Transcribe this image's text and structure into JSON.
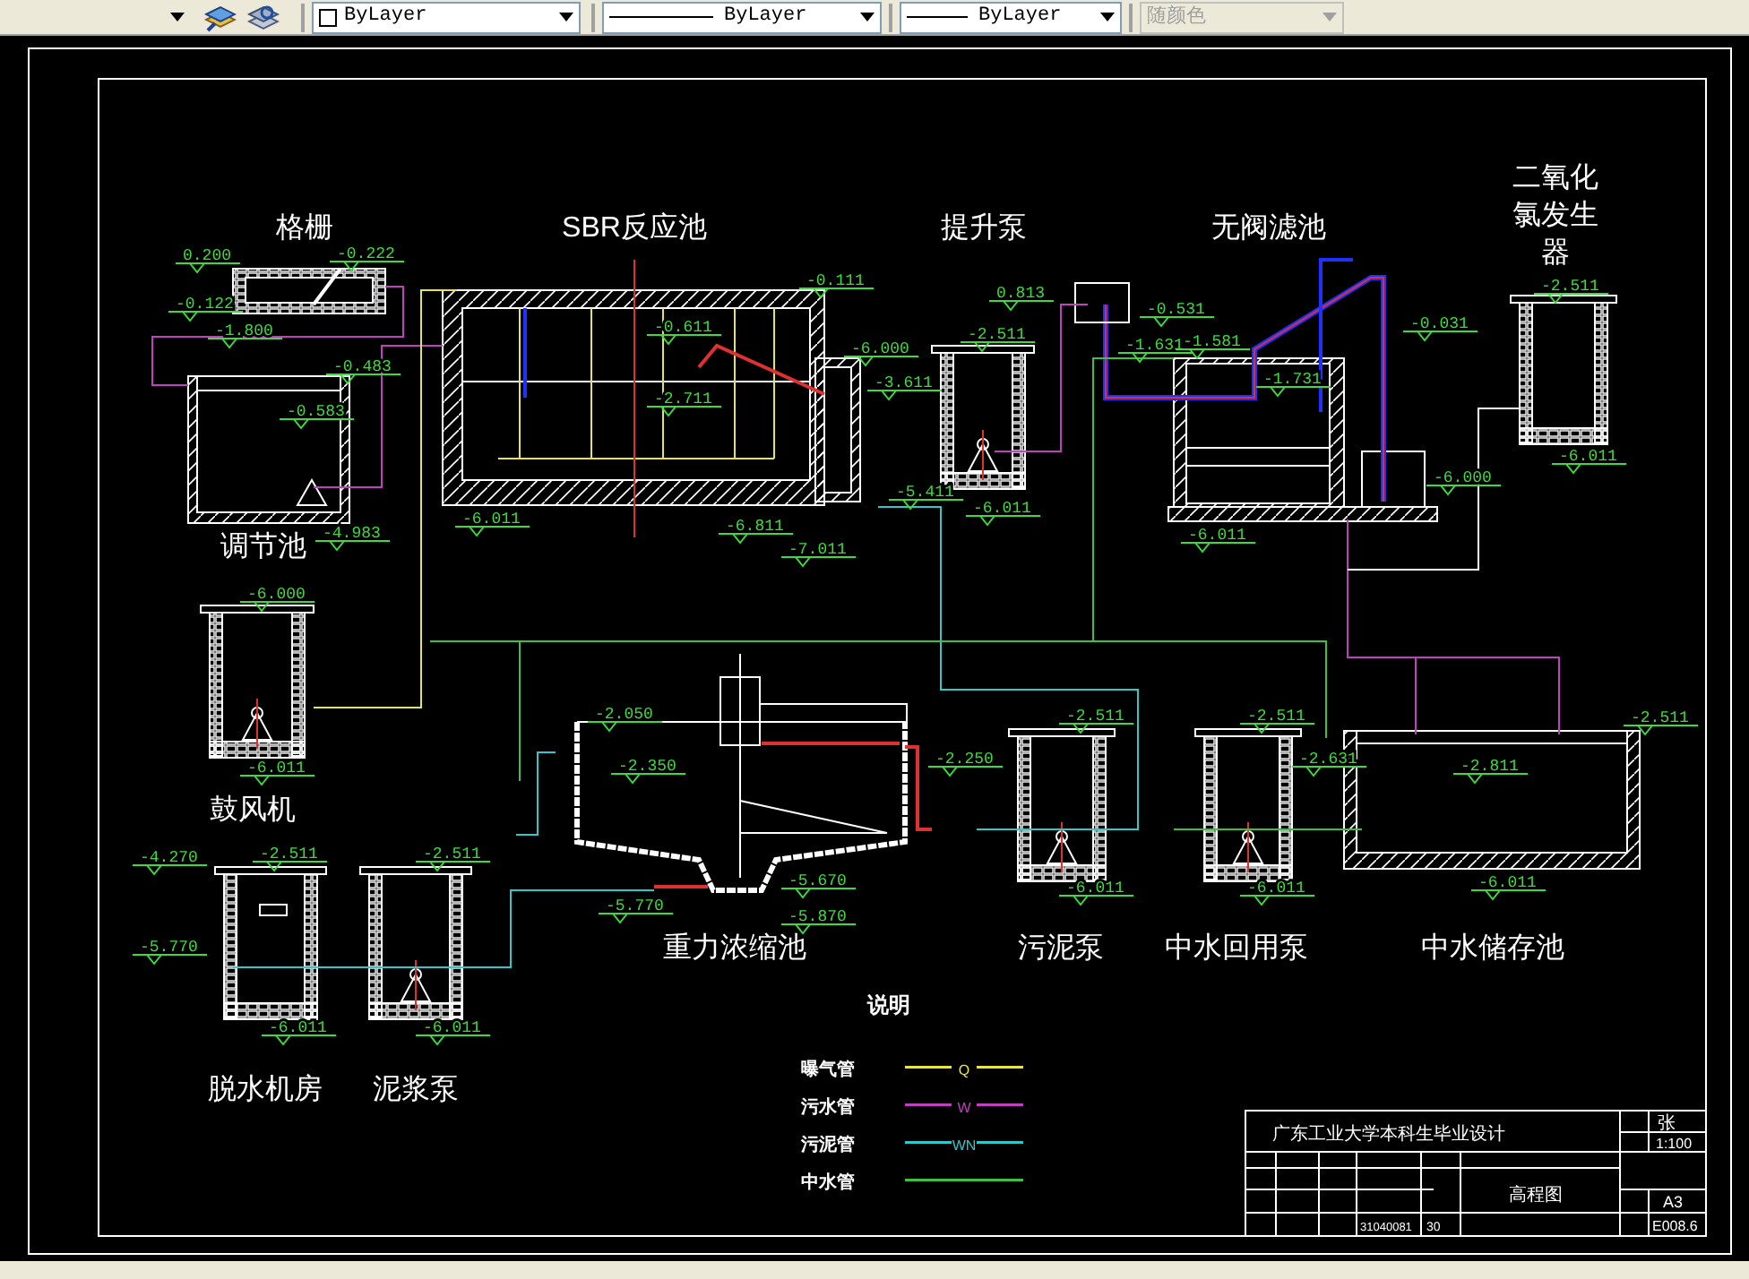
{
  "toolbar": {
    "color_control": "ByLayer",
    "linetype": "ByLayer",
    "lineweight": "ByLayer",
    "plot_style": {
      "value": "随颜色",
      "disabled": true
    }
  },
  "drawing": {
    "units": [
      {
        "name_lines": [
          "格栅"
        ],
        "elevations": [
          "0.200",
          "-0.122",
          "-0.222",
          "-1.800"
        ]
      },
      {
        "name_lines": [
          "调节池"
        ],
        "elevations": [
          "-0.483",
          "-0.583",
          "-4.983"
        ]
      },
      {
        "name_lines": [
          "SBR反应池"
        ],
        "elevations": [
          "-0.111",
          "-0.611",
          "-2.711",
          "-6.011",
          "-6.000",
          "-3.611",
          "-6.811",
          "-7.011"
        ]
      },
      {
        "name_lines": [
          "提升泵"
        ],
        "elevations": [
          "0.813",
          "-2.511",
          "-5.411",
          "-6.011"
        ]
      },
      {
        "name_lines": [
          "无阀滤池"
        ],
        "elevations": [
          "-0.531",
          "-1.631",
          "-1.581",
          "-1.731",
          "-0.031",
          "-6.000",
          "-6.011"
        ]
      },
      {
        "name_lines": [
          "二氧化",
          "氯发生",
          "器"
        ],
        "elevations": [
          "-2.511",
          "-6.011"
        ]
      },
      {
        "name_lines": [
          "鼓风机"
        ],
        "elevations": [
          "-6.000",
          "-6.011"
        ]
      },
      {
        "name_lines": [
          "重力浓缩池"
        ],
        "elevations": [
          "-2.050",
          "-2.350",
          "-2.250",
          "-5.670",
          "-5.870",
          "-5.770"
        ]
      },
      {
        "name_lines": [
          "污泥泵"
        ],
        "elevations": [
          "-2.511",
          "-6.011"
        ]
      },
      {
        "name_lines": [
          "中水回用泵"
        ],
        "elevations": [
          "-2.511",
          "-6.011",
          "-2.631"
        ]
      },
      {
        "name_lines": [
          "中水储存池"
        ],
        "elevations": [
          "-2.511",
          "-2.811",
          "-6.011"
        ]
      },
      {
        "name_lines": [
          "脱水机房"
        ],
        "elevations": [
          "-4.270",
          "-5.770",
          "-2.511",
          "-6.011"
        ]
      },
      {
        "name_lines": [
          "泥浆泵"
        ],
        "elevations": [
          "-2.511",
          "-6.011"
        ]
      }
    ],
    "legend": {
      "title": "说明",
      "items": [
        {
          "label": "曝气管",
          "symbol": "Q",
          "color": "#e6e64c"
        },
        {
          "label": "污水管",
          "symbol": "W",
          "color": "#c040c0"
        },
        {
          "label": "污泥管",
          "symbol": "WN",
          "color": "#30c8c8"
        },
        {
          "label": "中水管",
          "color": "#40c040"
        }
      ]
    },
    "title_block": {
      "school": "广东工业大学本科生毕业设计",
      "sheet": "张",
      "scale": "1:100",
      "drawing_title": "高程图",
      "size": "A3",
      "date": "E008.6",
      "student_no": "31040081",
      "student_no_suffix": "30"
    }
  }
}
